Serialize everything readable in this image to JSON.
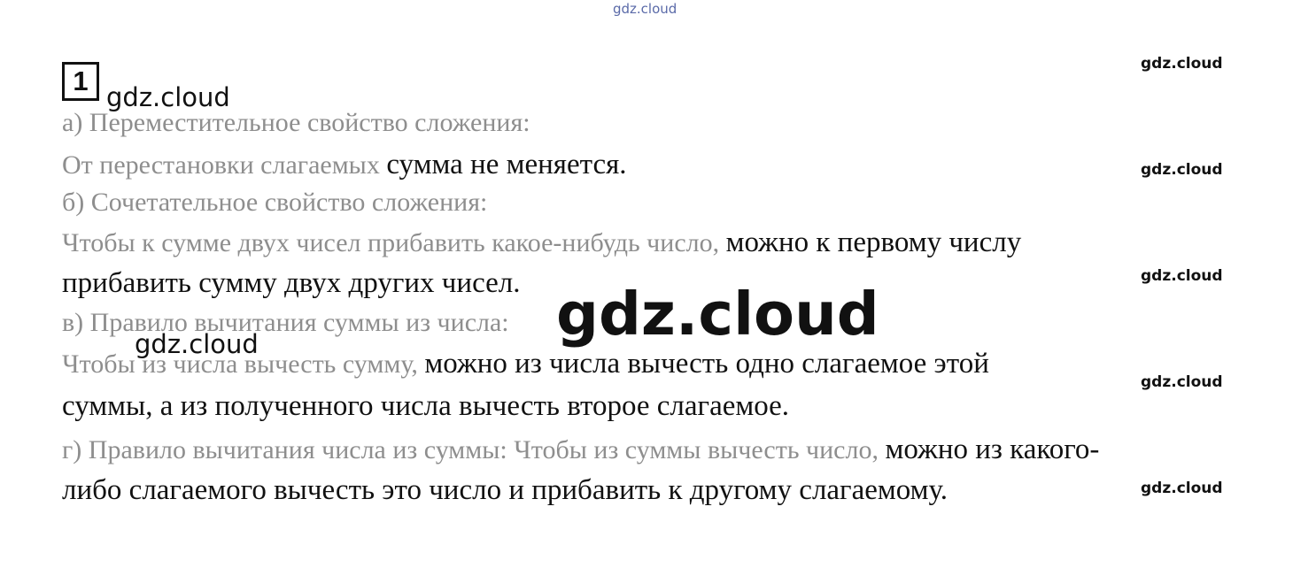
{
  "watermarks": {
    "top": "gdz.cloud",
    "right": [
      "gdz.cloud",
      "gdz.cloud",
      "gdz.cloud",
      "gdz.cloud",
      "gdz.cloud"
    ],
    "heading": "gdz.cloud",
    "mid_left": "gdz.cloud",
    "center": "gdz.cloud"
  },
  "task": {
    "number": "1",
    "a_heading": "а) Переместительное свойство сложения:",
    "a_text_start": "От перестановки слагаемых ",
    "a_text_end": "сумма не меняется.",
    "b_heading": "б) Сочетательное свойство сложения:",
    "b_text_start": "Чтобы к сумме двух чисел прибавить какое-нибудь число, ",
    "b_text_end": "можно к первому числу",
    "b_text_line2": "прибавить сумму двух других чисел.",
    "c_heading": "в) Правило вычитания суммы из числа:",
    "c_text_start": "Чтобы из числа вычесть сумму, ",
    "c_text_end": "можно из числа вычесть одно слагаемое этой",
    "c_text_line2": "суммы, а из полученного числа вычесть второе слагаемое.",
    "d_text_start": "г) Правило вычитания числа из суммы: Чтобы из суммы вычесть число, ",
    "d_text_end": "можно из какого-",
    "d_text_line2": "либо слагаемого вычесть это число и прибавить к другому слагаемому."
  }
}
